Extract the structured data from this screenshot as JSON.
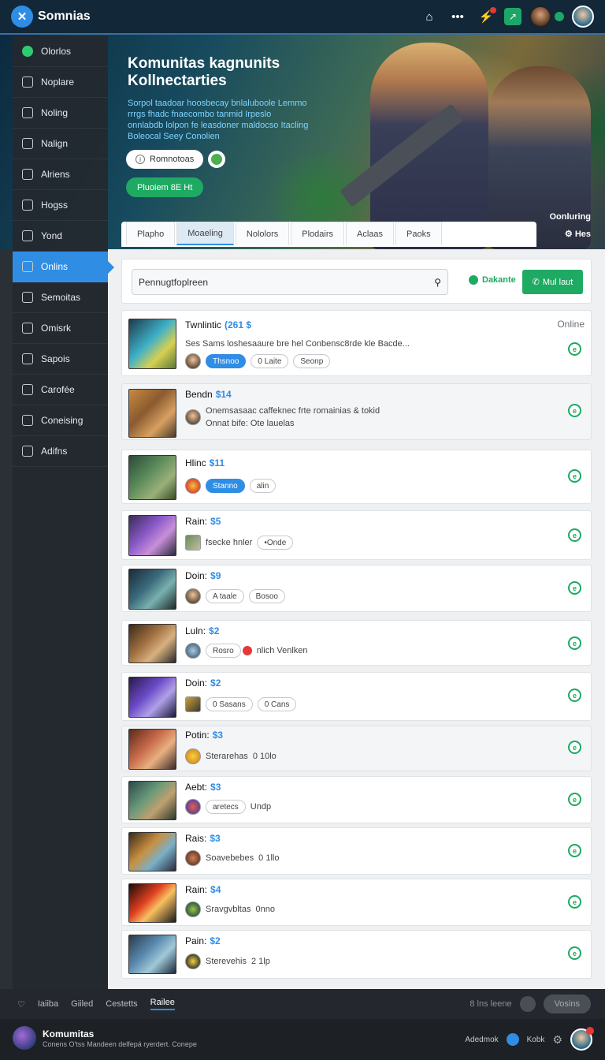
{
  "app": {
    "title": "Somnias"
  },
  "topbar": {
    "icons": [
      "home-icon",
      "more-icon",
      "notification-icon",
      "chart-icon",
      "user-avatar",
      "profile-avatar"
    ]
  },
  "hero": {
    "title": "Komunitas kagnunits Kollnectarties",
    "subtitle": "Sorpol taadoar hoosbecay bnlaluboole Lemmo rrrgs fhadc fnaecombo tanmid Irpeslo onnlabdb lolpon fe leasdoner maldocso Itacling Boleocal Seey Conolien",
    "pill_label": "Romnotoas",
    "green_button": "Pluoiem 8E Ht",
    "corner_label": "Oonluring",
    "corner_sub": "Hes"
  },
  "sidebar": {
    "items": [
      {
        "label": "Olorlos",
        "icon": "star-icon"
      },
      {
        "label": "Noplare",
        "icon": "phone-icon"
      },
      {
        "label": "Noling",
        "icon": "home-icon"
      },
      {
        "label": "Nalign",
        "icon": "image-icon"
      },
      {
        "label": "Alriens",
        "icon": "circle-icon"
      },
      {
        "label": "Hogss",
        "icon": "square-icon"
      },
      {
        "label": "Yond",
        "icon": "shirt-icon"
      },
      {
        "label": "Onlins",
        "icon": "grid-icon"
      },
      {
        "label": "Semoitas",
        "icon": "search-icon"
      },
      {
        "label": "Omisrk",
        "icon": "square-icon"
      },
      {
        "label": "Sapois",
        "icon": "search-icon"
      },
      {
        "label": "Carofée",
        "icon": "globe-icon"
      },
      {
        "label": "Coneising",
        "icon": "search-icon"
      },
      {
        "label": "Adifns",
        "icon": "search-icon"
      }
    ]
  },
  "tabs": [
    {
      "label": "Plapho"
    },
    {
      "label": "Moaeling"
    },
    {
      "label": "Nololors"
    },
    {
      "label": "Plodairs"
    },
    {
      "label": "Aclaas"
    },
    {
      "label": "Paoks"
    }
  ],
  "search": {
    "value": "Pennugtfoplreen",
    "filter_label": "Dakante",
    "button_label": "Mul laut"
  },
  "rows": [
    {
      "name": "Twnlintic",
      "price": "(261 $",
      "status": "Online",
      "desc": "Ses Sams loshesaaure bre hel Conbensc8rde kle Bacde...",
      "chips": [
        "Thsnoo",
        "0 Laite",
        "Seonp"
      ]
    },
    {
      "name": "Bendn",
      "price": "$14",
      "desc": "Onemsasaac caffeknec frte romainias & tokid",
      "desc2": "Onnat bife: Ote lauelas",
      "chips": []
    },
    {
      "name": "Hlinc",
      "price": "$11",
      "chips": [
        "Stanno",
        "alin"
      ]
    },
    {
      "name": "Rain:",
      "price": "$5",
      "meta": "fsecke hnler",
      "chips": [
        "Onde"
      ]
    },
    {
      "name": "Doin:",
      "price": "$9",
      "chips": [
        "A taale",
        "Bosoo"
      ]
    },
    {
      "name": "Luln:",
      "price": "$2",
      "chips": [
        "Rosro"
      ],
      "meta": "nlich Venlken"
    },
    {
      "name": "Doin:",
      "price": "$2",
      "chips": [
        "0 Sasans",
        "0 Cans"
      ]
    },
    {
      "name": "Potin:",
      "price": "$3",
      "meta": "Sterarehas",
      "meta2": "0 10lo"
    },
    {
      "name": "Aebt:",
      "price": "$3",
      "chips": [
        "aretecs"
      ],
      "meta2": "Undp"
    },
    {
      "name": "Rais:",
      "price": "$3",
      "meta": "Soavebebes",
      "meta2": "0 1llo"
    },
    {
      "name": "Rain:",
      "price": "$4",
      "meta": "Sravgvbltas",
      "meta2": "0nno"
    },
    {
      "name": "Pain:",
      "price": "$2",
      "meta": "Sterevehis",
      "meta2": "2 1lp"
    }
  ],
  "bottom_bar": {
    "tabs": [
      "Iaiiba",
      "Giiled",
      "Cestetts",
      "Railee"
    ],
    "right_text": "8 lns leene",
    "right_pill": "Vosins"
  },
  "footer": {
    "title": "Komumitas",
    "subtitle": "Conens O'tss Mandeen delfepá ryerdert. Conepe",
    "right_label": "Adedmok",
    "right_label2": "Kobk"
  }
}
